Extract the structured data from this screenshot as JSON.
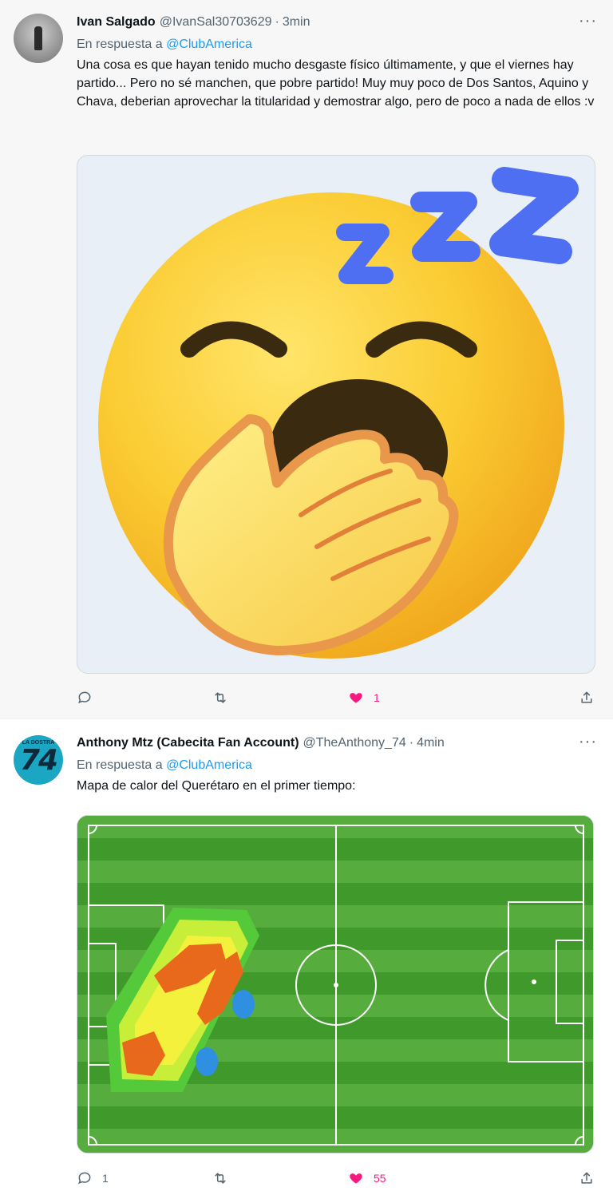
{
  "tweets": [
    {
      "author_name": "Ivan Salgado",
      "handle": "@IvanSal30703629",
      "separator": "·",
      "time": "3min",
      "reply_prefix": "En respuesta a",
      "reply_to": "@ClubAmerica",
      "text": "Una cosa es que hayan tenido mucho desgaste físico últimamente, y que el viernes hay partido... Pero no sé manchen, que pobre partido! Muy muy poco de Dos Santos, Aquino y Chava, deberian aprovechar la titularidad y demostrar algo, pero de poco a nada de ellos :v",
      "media": "yawning-face-emoji",
      "more_label": "···",
      "replies": "",
      "retweets": "",
      "likes": "1",
      "liked": true
    },
    {
      "author_name": "Anthony Mtz (Cabecita Fan Account)",
      "handle": "@TheAnthony_74",
      "separator": "·",
      "time": "4min",
      "reply_prefix": "En respuesta a",
      "reply_to": "@ClubAmerica",
      "text": "Mapa de calor del Querétaro en el primer tiempo:",
      "media": "football-pitch-heatmap",
      "avatar_text": "74",
      "avatar_small_text": "LA DOSTRA",
      "more_label": "···",
      "replies": "1",
      "retweets": "",
      "likes": "55",
      "liked": true
    }
  ],
  "colors": {
    "link": "#1d9bf0",
    "muted": "#536471",
    "like": "#f91880",
    "pitch_green": "#3e8e27"
  }
}
